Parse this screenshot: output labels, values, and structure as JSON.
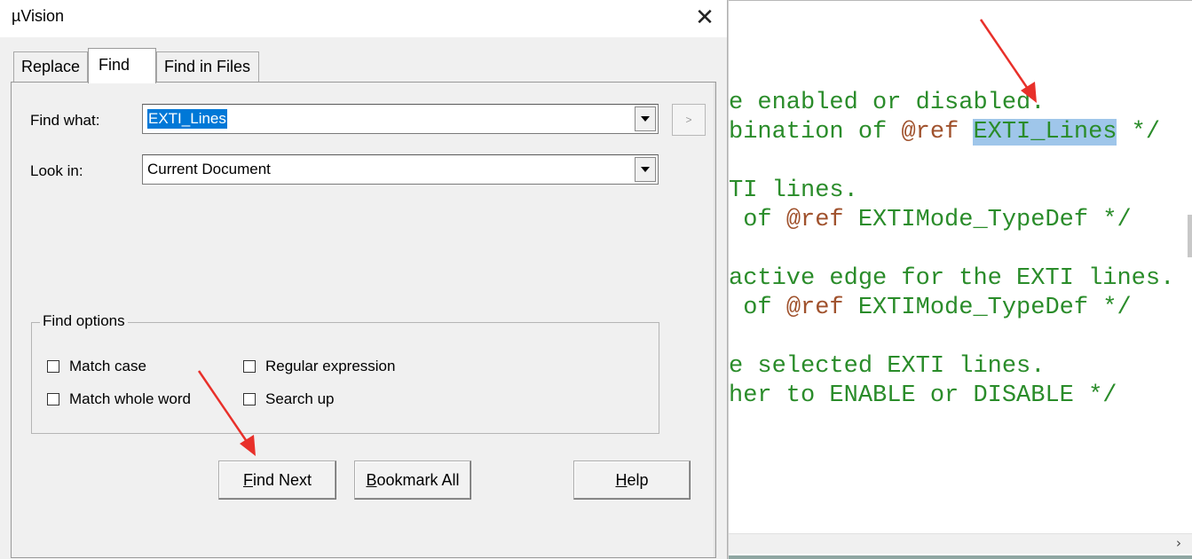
{
  "dialog": {
    "title": "µVision",
    "close_label": "✕",
    "tabs": [
      {
        "label": "Replace",
        "active": false
      },
      {
        "label": "Find",
        "active": true
      },
      {
        "label": "Find in Files",
        "active": false
      }
    ],
    "find_what": {
      "label": "Find what:",
      "value": "EXTI_Lines"
    },
    "look_in": {
      "label": "Look in:",
      "value": "Current Document"
    },
    "history_button": ">",
    "find_options": {
      "legend": "Find options",
      "match_case": {
        "label": "Match case",
        "checked": false
      },
      "match_whole_word": {
        "label": "Match whole word",
        "checked": false
      },
      "regular_expression": {
        "label": "Regular expression",
        "checked": false
      },
      "search_up": {
        "label": "Search up",
        "checked": false
      }
    },
    "buttons": {
      "find_next": {
        "mnemonic": "F",
        "rest": "ind Next"
      },
      "bookmark_all": {
        "mnemonic": "B",
        "rest": "ookmark All"
      },
      "help": {
        "mnemonic": "H",
        "rest": "elp"
      }
    }
  },
  "editor": {
    "lines": [
      {
        "text": "e enabled or disabled."
      },
      {
        "pre": "bination of ",
        "ref": "@ref",
        "mid": " ",
        "hl": "EXTI_Lines",
        "post": " */"
      },
      {
        "text": "TI lines."
      },
      {
        "pre": " of ",
        "ref": "@ref",
        "post": " EXTIMode_TypeDef */"
      },
      {
        "text": "active edge for the EXTI lines."
      },
      {
        "pre": " of ",
        "ref": "@ref",
        "post": " EXTIMode_TypeDef */"
      },
      {
        "text": "e selected EXTI lines."
      },
      {
        "text": "her to ENABLE or DISABLE */"
      }
    ],
    "hscroll_arrow": "›",
    "colors": {
      "comment": "#2a8c2a",
      "ref": "#a0522d",
      "highlight": "#9fc6ea"
    }
  },
  "annotations": {
    "arrow_color": "#e8302a"
  }
}
